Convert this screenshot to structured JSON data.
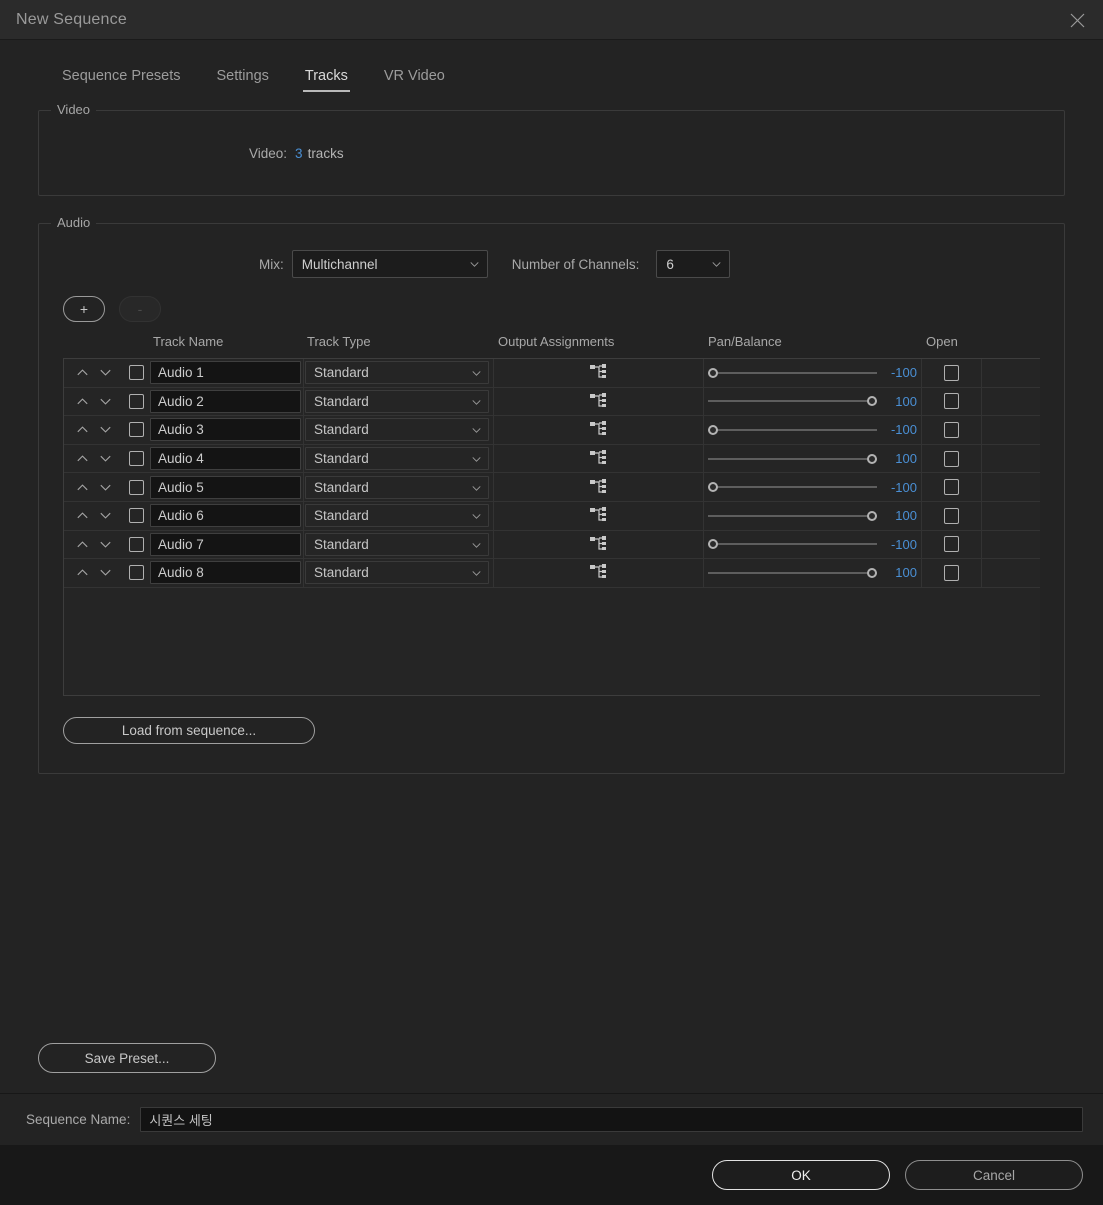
{
  "window": {
    "title": "New Sequence",
    "close_icon": "close-icon"
  },
  "tabs": [
    {
      "label": "Sequence Presets",
      "active": false
    },
    {
      "label": "Settings",
      "active": false
    },
    {
      "label": "Tracks",
      "active": true
    },
    {
      "label": "VR Video",
      "active": false
    }
  ],
  "video_group": {
    "legend": "Video",
    "tracks_label": "Video:",
    "tracks_value": "3",
    "tracks_suffix": "tracks"
  },
  "audio_group": {
    "legend": "Audio",
    "mix_label": "Mix:",
    "mix_value": "Multichannel",
    "channels_label": "Number of Channels:",
    "channels_value": "6",
    "add_button": "+",
    "remove_button": "-",
    "load_from_sequence": "Load from sequence...",
    "columns": [
      "Track Name",
      "Track Type",
      "Output Assignments",
      "Pan/Balance",
      "Open"
    ],
    "rows": [
      {
        "name": "Audio 1",
        "type": "Standard",
        "pan": "-100",
        "pan_side": "left",
        "output_icon": "routing-icon",
        "open_checked": false,
        "select_checked": false
      },
      {
        "name": "Audio 2",
        "type": "Standard",
        "pan": "100",
        "pan_side": "right",
        "output_icon": "routing-icon",
        "open_checked": false,
        "select_checked": false
      },
      {
        "name": "Audio 3",
        "type": "Standard",
        "pan": "-100",
        "pan_side": "left",
        "output_icon": "routing-icon",
        "open_checked": false,
        "select_checked": false
      },
      {
        "name": "Audio 4",
        "type": "Standard",
        "pan": "100",
        "pan_side": "right",
        "output_icon": "routing-icon",
        "open_checked": false,
        "select_checked": false
      },
      {
        "name": "Audio 5",
        "type": "Standard",
        "pan": "-100",
        "pan_side": "left",
        "output_icon": "routing-icon",
        "open_checked": false,
        "select_checked": false
      },
      {
        "name": "Audio 6",
        "type": "Standard",
        "pan": "100",
        "pan_side": "right",
        "output_icon": "routing-icon",
        "open_checked": false,
        "select_checked": false
      },
      {
        "name": "Audio 7",
        "type": "Standard",
        "pan": "-100",
        "pan_side": "left",
        "output_icon": "routing-icon",
        "open_checked": false,
        "select_checked": false
      },
      {
        "name": "Audio 8",
        "type": "Standard",
        "pan": "100",
        "pan_side": "right",
        "output_icon": "routing-icon",
        "open_checked": false,
        "select_checked": false
      }
    ]
  },
  "save_preset_label": "Save Preset...",
  "sequence_name": {
    "label": "Sequence Name:",
    "value": "시퀀스 세팅"
  },
  "footer": {
    "ok": "OK",
    "cancel": "Cancel"
  },
  "colors": {
    "accent_blue": "#4a8fd4",
    "dialog_bg": "#232323",
    "titlebar_bg": "#2b2b2b",
    "footer_bg": "#181818",
    "text": "#b4b4b4"
  }
}
